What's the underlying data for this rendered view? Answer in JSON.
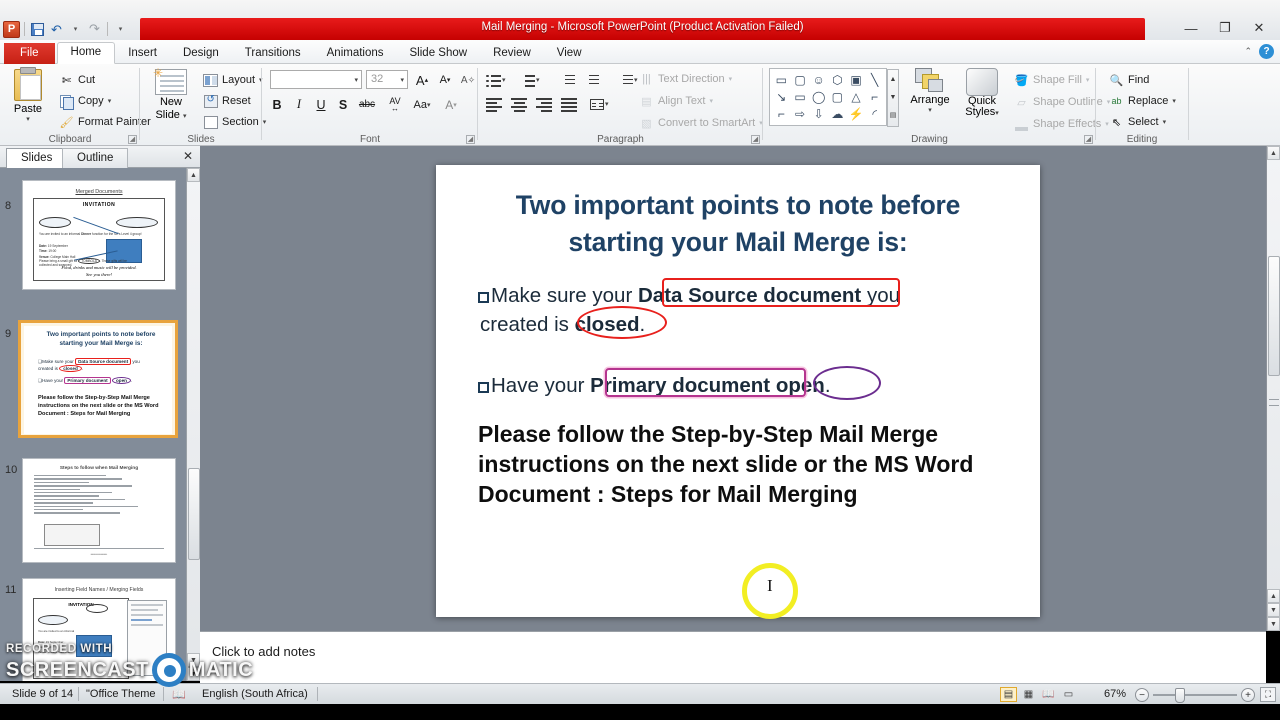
{
  "window": {
    "title": "Mail Merging  -  Microsoft PowerPoint (Product Activation Failed)",
    "minimize": "—",
    "restore": "❐",
    "close": "✕",
    "help": "?",
    "collapse_ribbon": "⌃"
  },
  "quick_access": {
    "app_letter": "P",
    "save": "save-icon",
    "undo": "↶",
    "redo": "↷",
    "customize": "▾"
  },
  "tabs": [
    {
      "label": "File",
      "active": false,
      "file": true
    },
    {
      "label": "Home",
      "active": true
    },
    {
      "label": "Insert",
      "active": false
    },
    {
      "label": "Design",
      "active": false
    },
    {
      "label": "Transitions",
      "active": false
    },
    {
      "label": "Animations",
      "active": false
    },
    {
      "label": "Slide Show",
      "active": false
    },
    {
      "label": "Review",
      "active": false
    },
    {
      "label": "View",
      "active": false
    }
  ],
  "ribbon": {
    "clipboard": {
      "label": "Clipboard",
      "paste": "Paste",
      "cut": "Cut",
      "copy": "Copy",
      "format_painter": "Format Painter"
    },
    "slides": {
      "label": "Slides",
      "new_slide": "New",
      "new_slide2": "Slide",
      "layout": "Layout",
      "reset": "Reset",
      "section": "Section"
    },
    "font": {
      "label": "Font",
      "font_name": "",
      "font_size": "32",
      "grow": "A",
      "shrink": "A",
      "clear_formatting": "Aa",
      "bold": "B",
      "italic": "I",
      "underline": "U",
      "shadow": "S",
      "strikethrough": "abc",
      "character_spacing": "AV",
      "change_case": "Aa",
      "font_color": "A"
    },
    "paragraph": {
      "label": "Paragraph",
      "text_direction": "Text Direction",
      "align_text": "Align Text",
      "convert_smartart": "Convert to SmartArt"
    },
    "drawing": {
      "label": "Drawing",
      "arrange": "Arrange",
      "quick_styles1": "Quick",
      "quick_styles2": "Styles",
      "shape_fill": "Shape Fill",
      "shape_outline": "Shape Outline",
      "shape_effects": "Shape Effects"
    },
    "editing": {
      "label": "Editing",
      "find": "Find",
      "replace": "Replace",
      "select": "Select"
    }
  },
  "panel": {
    "tab_slides": "Slides",
    "tab_outline": "Outline",
    "close": "✕",
    "thumbnails": [
      {
        "number": "8",
        "title": "Merged Documents",
        "selected": false
      },
      {
        "number": "9",
        "title": "Two important points to note before starting your Mail Merge is:",
        "selected": true
      },
      {
        "number": "10",
        "title": "Steps to follow when Mail Merging",
        "selected": false
      },
      {
        "number": "11",
        "title": "Inserting Field Names / Merging Fields",
        "selected": false
      }
    ]
  },
  "slide": {
    "title_line1": "Two important points to note before",
    "title_line2": "starting your Mail Merge is:",
    "bullet1_pre": "Make sure your ",
    "bullet1_bold": "Data Source document",
    "bullet1_post": " you",
    "bullet1_line2_pre": "created is ",
    "bullet1_line2_bold": "closed",
    "bullet1_line2_post": ".",
    "bullet2_pre": "Have your ",
    "bullet2_bold": "Primary document",
    "bullet2_post": " ",
    "bullet2_bold2": "open",
    "bullet2_end": ".",
    "paragraph": "Please follow the Step-by-Step Mail Merge instructions on the next slide or the MS Word Document : Steps for Mail Merging",
    "title_color": "#1f4265",
    "annotation_red": "#e8201c",
    "annotation_magenta": "#b5358f",
    "annotation_purple": "#6b2d8f",
    "cursor_highlight": "#f2ee23"
  },
  "notes": {
    "placeholder": "Click to add notes"
  },
  "status": {
    "slide_count": "Slide 9 of 14",
    "theme": "\"Office Theme",
    "language": "English (South Africa)",
    "zoom": "67%",
    "zoom_out": "−",
    "zoom_in": "+",
    "view_normal": "normal-view-icon",
    "view_sorter": "slide-sorter-icon",
    "view_reading": "reading-view-icon",
    "view_show": "slide-show-icon",
    "fit_slide": "fit-slide-icon"
  },
  "watermark": {
    "line1": "RECORDED WITH",
    "line2a": "SCREENCAST",
    "line2b": "MATIC"
  }
}
